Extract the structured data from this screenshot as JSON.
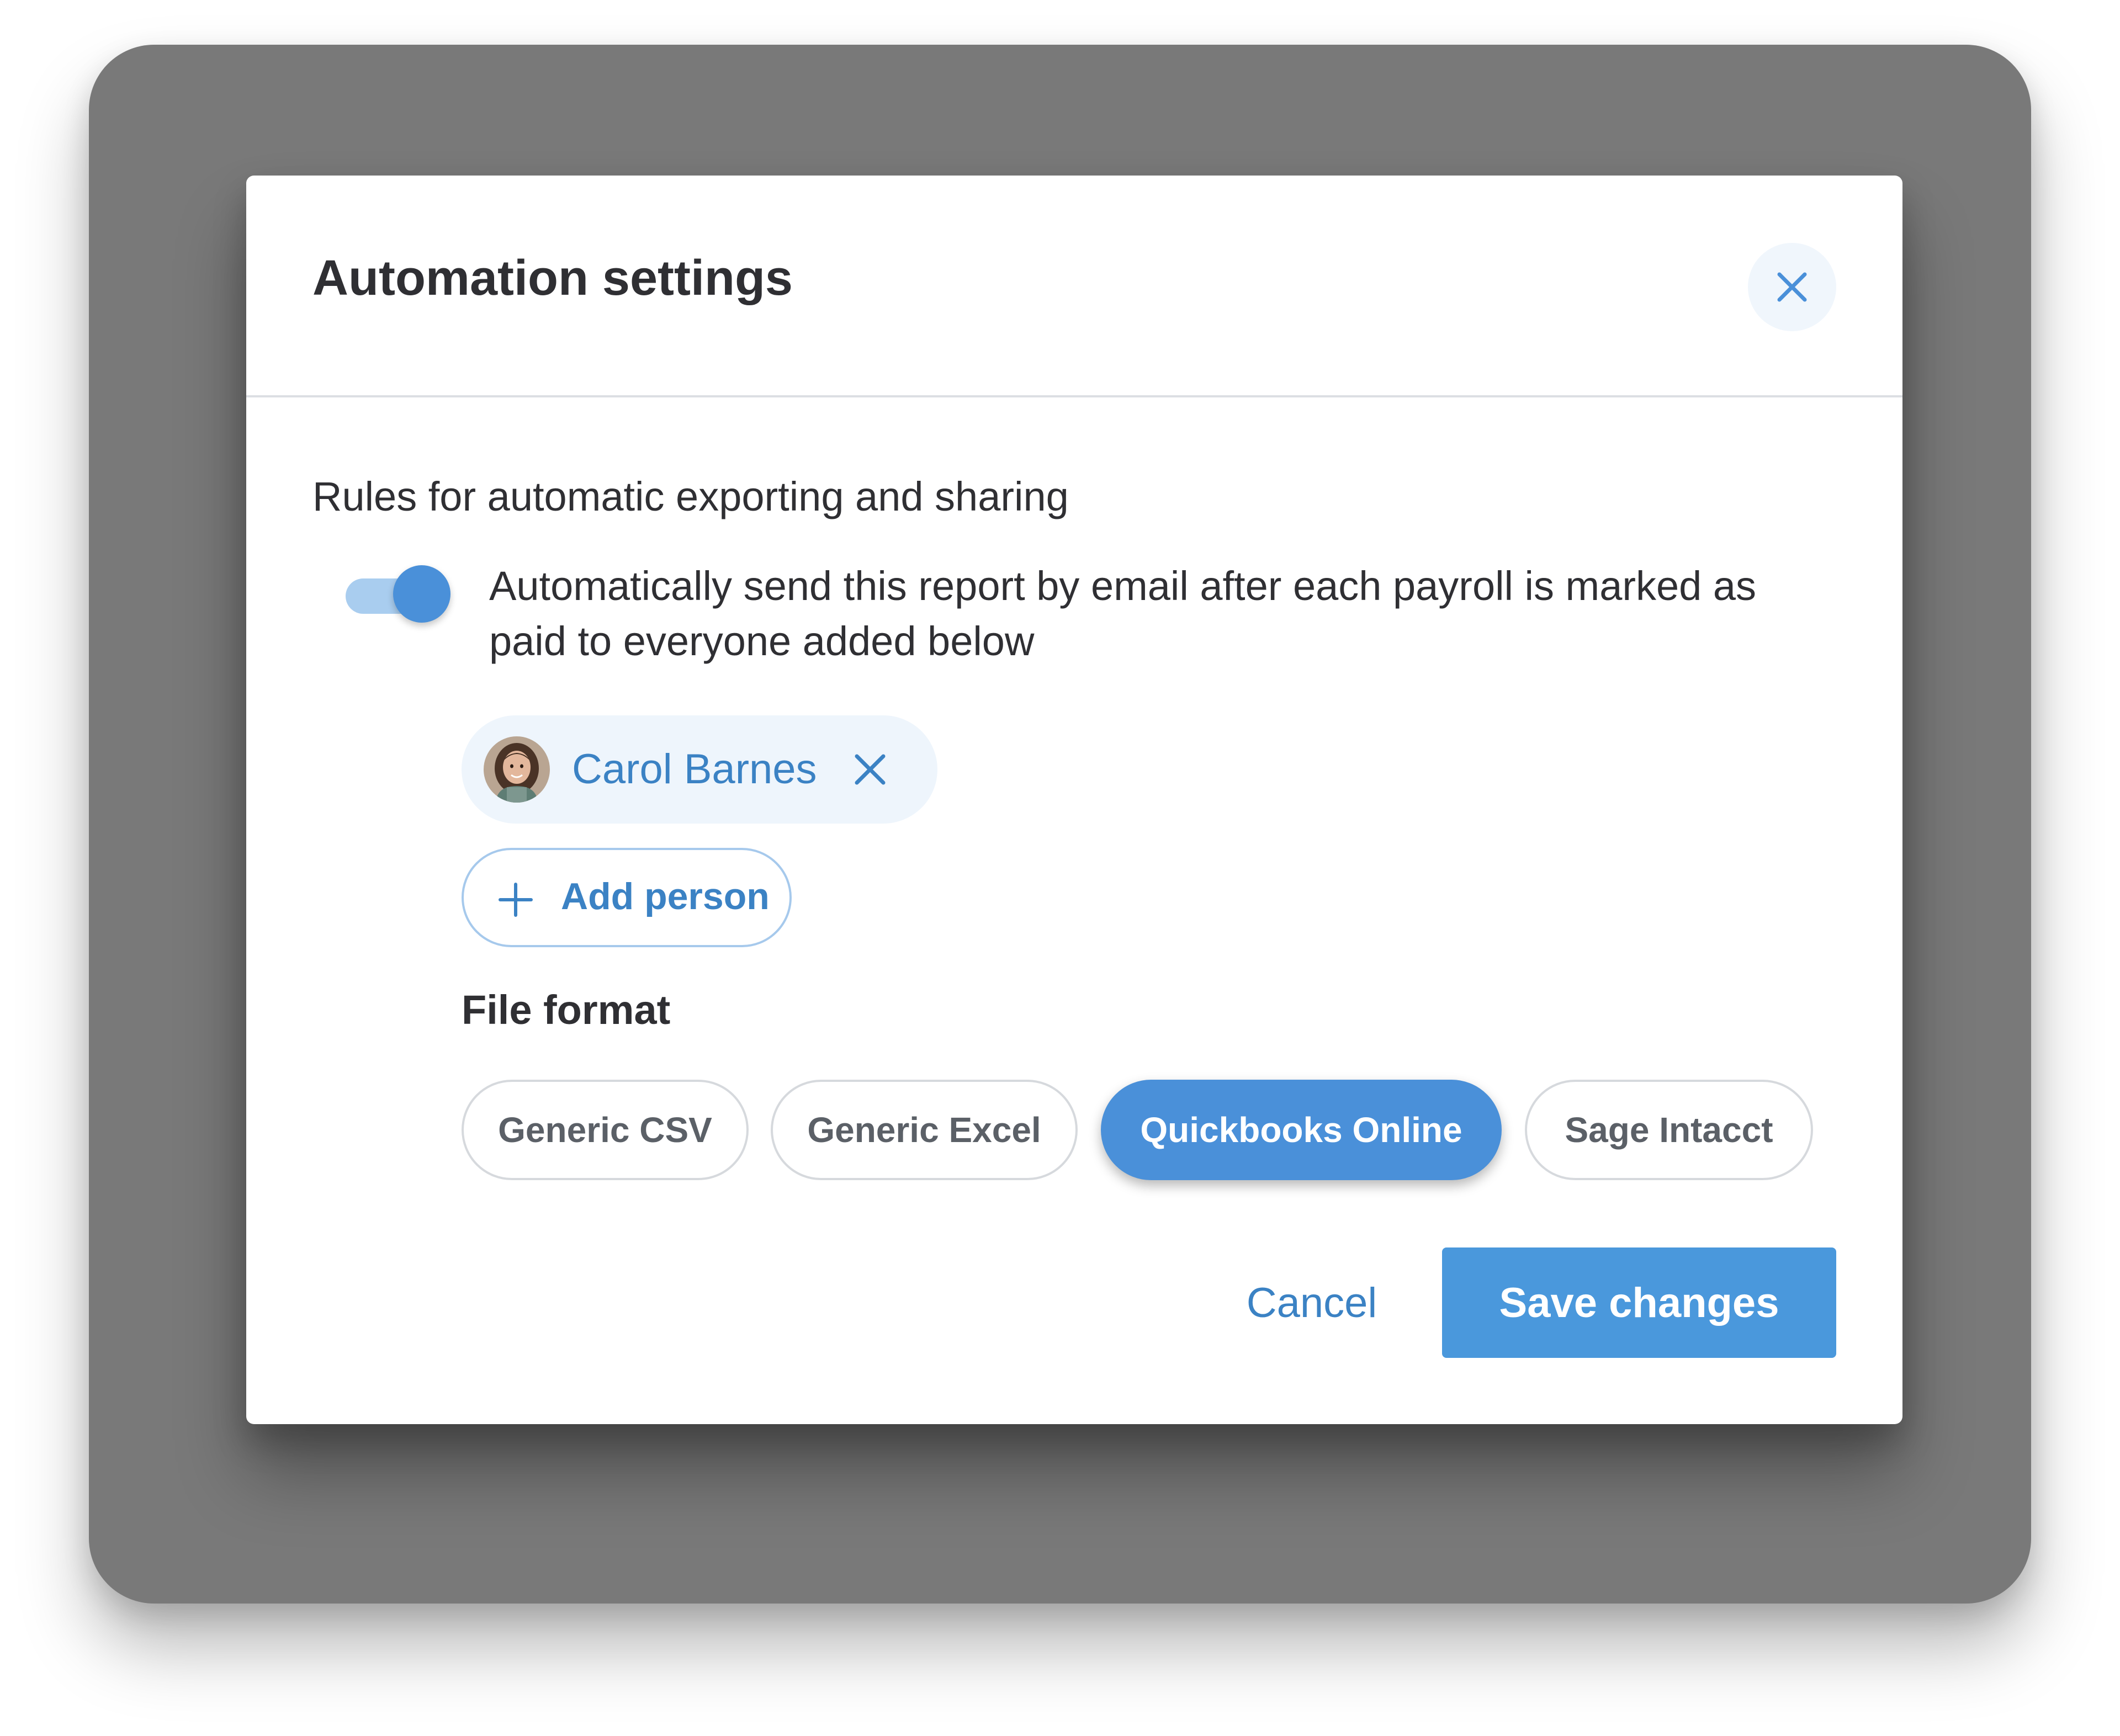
{
  "dialog": {
    "title": "Automation settings",
    "close_icon": "close-icon"
  },
  "rules": {
    "heading": "Rules for automatic exporting and sharing",
    "auto_send": {
      "enabled": true,
      "text": "Automatically send this report by email after each payroll is marked as paid to everyone added below"
    }
  },
  "recipients": [
    {
      "name": "Carol Barnes",
      "remove_icon": "close-icon"
    }
  ],
  "add_person": {
    "label": "Add person",
    "icon": "plus-icon"
  },
  "file_format": {
    "label": "File format",
    "selected": "Quickbooks Online",
    "options": [
      "Generic CSV",
      "Generic Excel",
      "Quickbooks Online",
      "Sage Intacct"
    ]
  },
  "actions": {
    "cancel_label": "Cancel",
    "save_label": "Save changes"
  },
  "colors": {
    "accent": "#4a90d9",
    "link": "#3b82c4",
    "chip_background": "#eef5fc",
    "backdrop": "#797979"
  }
}
